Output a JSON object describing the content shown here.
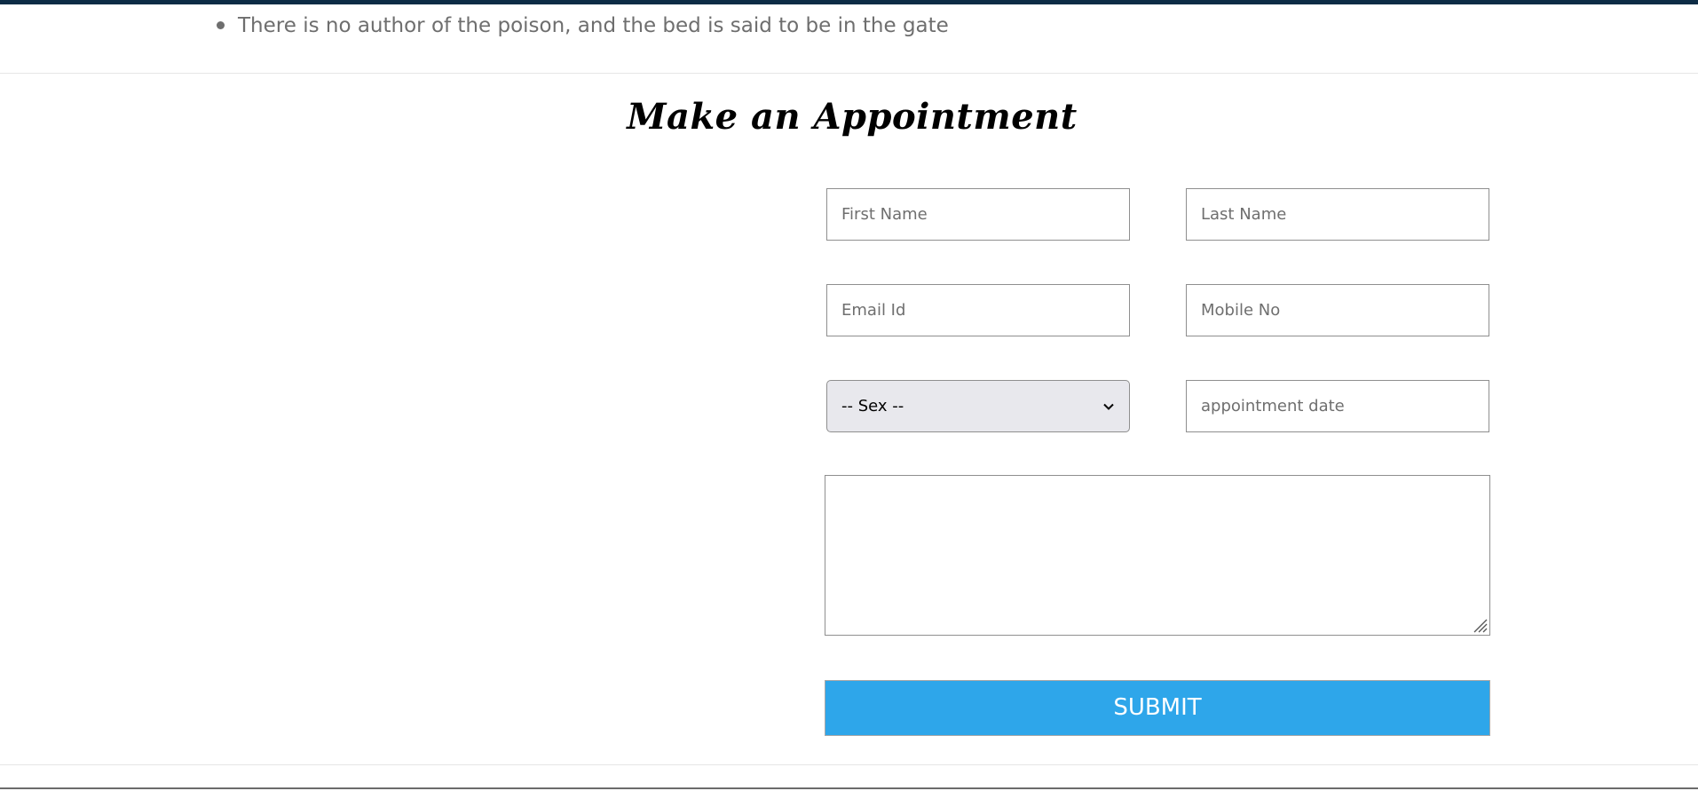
{
  "content": {
    "bullets": [
      "There is no author of the poison, and the bed is said to be in the gate"
    ]
  },
  "appointment": {
    "title": "Make an Appointment",
    "first_name_placeholder": "First Name",
    "last_name_placeholder": "Last Name",
    "email_placeholder": "Email Id",
    "mobile_placeholder": "Mobile No",
    "sex_selected": "-- Sex --",
    "date_placeholder": "appointment date",
    "message_value": "",
    "submit_label": "SUBMIT"
  },
  "colors": {
    "accent": "#0d2c45",
    "submit_bg": "#2ea6ea",
    "bullet_text": "#6e6e6e"
  },
  "icons": {
    "select_arrow": "chevron-down-icon",
    "textarea_resize": "resize-grip-icon"
  }
}
